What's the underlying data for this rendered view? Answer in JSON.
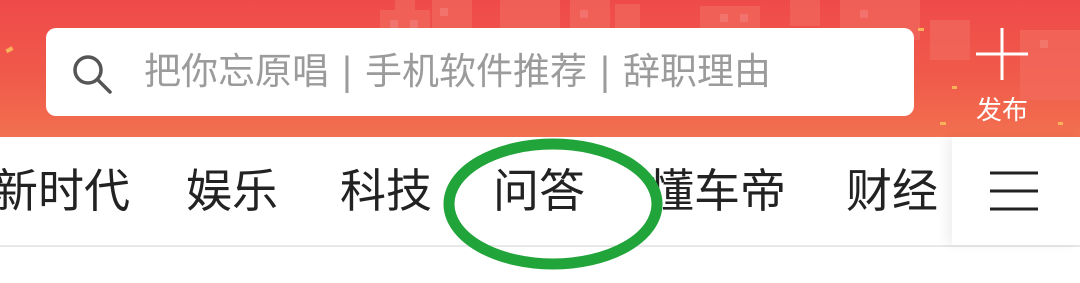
{
  "search": {
    "icon": "search-icon",
    "placeholder": "把你忘原唱 | 手机软件推荐 | 辞职理由"
  },
  "publish": {
    "icon": "plus-icon",
    "label": "发布"
  },
  "tabs": [
    {
      "label": "新时代"
    },
    {
      "label": "娱乐"
    },
    {
      "label": "科技"
    },
    {
      "label": "问答"
    },
    {
      "label": "懂车帝"
    },
    {
      "label": "财经"
    }
  ],
  "menu": {
    "icon": "menu-icon"
  },
  "annotation": {
    "shape": "ellipse",
    "color": "#21a43a"
  },
  "colors": {
    "header_top": "#ef4a4a",
    "header_bottom": "#f27050",
    "tab_text": "#222222",
    "placeholder_text": "#9b9b9b"
  }
}
